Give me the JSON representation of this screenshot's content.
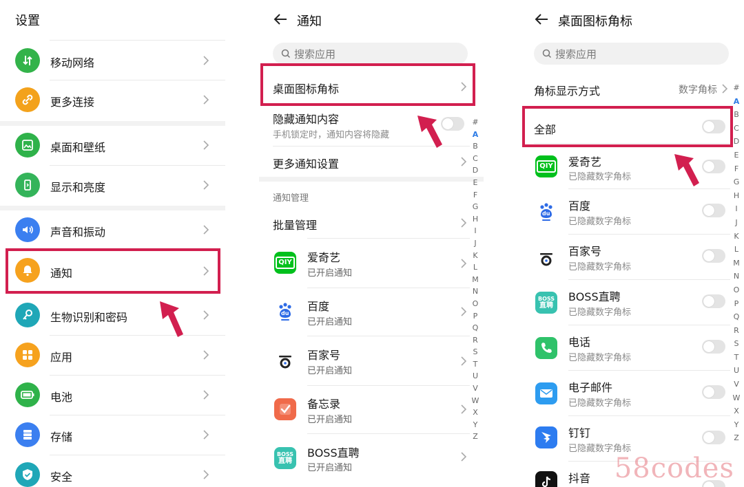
{
  "panel1": {
    "title": "设置",
    "items": [
      {
        "label": "移动网络",
        "color": "#33b34a"
      },
      {
        "label": "更多连接",
        "color": "#f3a21c"
      },
      {
        "label": "桌面和壁纸",
        "color": "#2fb24a"
      },
      {
        "label": "显示和亮度",
        "color": "#34b45a"
      },
      {
        "label": "声音和振动",
        "color": "#3b7ff0"
      },
      {
        "label": "通知",
        "color": "#f6a21e"
      },
      {
        "label": "生物识别和密码",
        "color": "#1fa7b7"
      },
      {
        "label": "应用",
        "color": "#f6a21e"
      },
      {
        "label": "电池",
        "color": "#2fb24a"
      },
      {
        "label": "存储",
        "color": "#3b7ff0"
      },
      {
        "label": "安全",
        "color": "#1fa7b7"
      }
    ]
  },
  "panel2": {
    "title": "通知",
    "search_placeholder": "搜索应用",
    "badge_row": "桌面图标角标",
    "hide_content": {
      "label": "隐藏通知内容",
      "sub": "手机锁定时，通知内容将隐藏"
    },
    "more_settings": "更多通知设置",
    "section": "通知管理",
    "batch": "批量管理",
    "apps": [
      {
        "name": "爱奇艺",
        "status": "已开启通知"
      },
      {
        "name": "百度",
        "status": "已开启通知"
      },
      {
        "name": "百家号",
        "status": "已开启通知"
      },
      {
        "name": "备忘录",
        "status": "已开启通知"
      },
      {
        "name": "BOSS直聘",
        "status": "已开启通知"
      }
    ],
    "index": [
      "#",
      "A",
      "B",
      "C",
      "D",
      "E",
      "F",
      "G",
      "H",
      "I",
      "J",
      "K",
      "L",
      "M",
      "N",
      "O",
      "P",
      "Q",
      "R",
      "S",
      "T",
      "U",
      "V",
      "W",
      "X",
      "Y",
      "Z"
    ]
  },
  "panel3": {
    "title": "桌面图标角标",
    "search_placeholder": "搜索应用",
    "display_mode": {
      "label": "角标显示方式",
      "value": "数字角标"
    },
    "all": "全部",
    "apps": [
      {
        "name": "爱奇艺",
        "status": "已隐藏数字角标"
      },
      {
        "name": "百度",
        "status": "已隐藏数字角标"
      },
      {
        "name": "百家号",
        "status": "已隐藏数字角标"
      },
      {
        "name": "BOSS直聘",
        "status": "已隐藏数字角标"
      },
      {
        "name": "电话",
        "status": "已隐藏数字角标"
      },
      {
        "name": "电子邮件",
        "status": "已隐藏数字角标"
      },
      {
        "name": "钉钉",
        "status": "已隐藏数字角标"
      },
      {
        "name": "抖音",
        "status": ""
      }
    ],
    "index": [
      "#",
      "A",
      "B",
      "C",
      "D",
      "E",
      "F",
      "G",
      "H",
      "I",
      "J",
      "K",
      "L",
      "M",
      "N",
      "O",
      "P",
      "Q",
      "R",
      "S",
      "T",
      "U",
      "V",
      "W",
      "X",
      "Y",
      "Z"
    ]
  },
  "icons": {
    "qiyi_text": "QIY",
    "baidu_text": "du",
    "boss_line1": "BOSS",
    "boss_line2": "直聘"
  },
  "colors": {
    "highlight": "#d21f4f",
    "accent": "#2c7be5"
  },
  "watermark": "58codes"
}
